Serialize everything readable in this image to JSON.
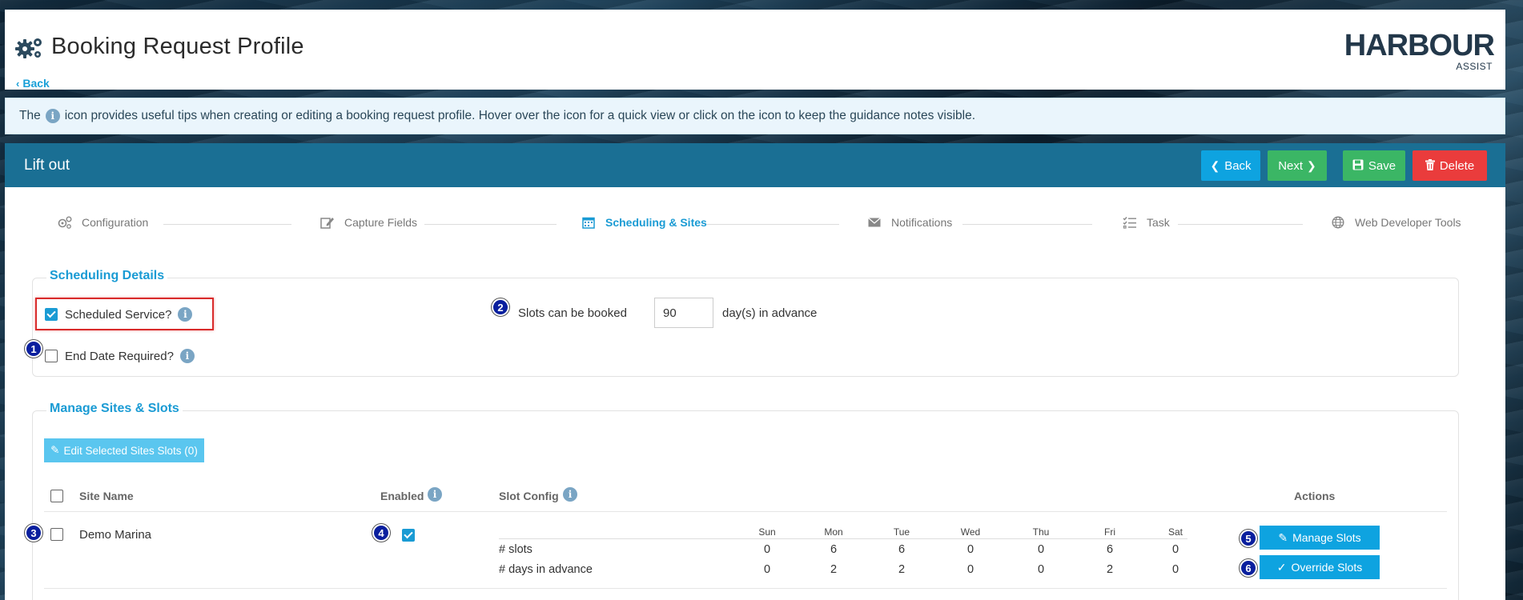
{
  "header": {
    "title": "Booking Request Profile",
    "back_label": "Back",
    "logo_main": "HARBOUR",
    "logo_sub": "ASSIST"
  },
  "tip": {
    "before": "The",
    "after": "icon provides useful tips when creating or editing a booking request profile. Hover over the icon for a quick view or click on the icon to keep the guidance notes visible."
  },
  "profile": {
    "name": "Lift out",
    "buttons": {
      "back": "Back",
      "next": "Next",
      "save": "Save",
      "delete": "Delete"
    }
  },
  "steps": [
    {
      "label": "Configuration",
      "icon": "cogs-icon",
      "active": false
    },
    {
      "label": "Capture Fields",
      "icon": "edit-icon",
      "active": false
    },
    {
      "label": "Scheduling & Sites",
      "icon": "calendar-icon",
      "active": true
    },
    {
      "label": "Notifications",
      "icon": "envelope-icon",
      "active": false
    },
    {
      "label": "Task",
      "icon": "tasklist-icon",
      "active": false
    },
    {
      "label": "Web Developer Tools",
      "icon": "globe-icon",
      "active": false
    }
  ],
  "scheduling": {
    "legend": "Scheduling Details",
    "scheduled_service_label": "Scheduled Service?",
    "scheduled_service_checked": true,
    "end_date_label": "End Date Required?",
    "end_date_checked": false,
    "slots_label": "Slots can be booked",
    "slots_value": "90",
    "slots_suffix": "day(s) in advance"
  },
  "sites": {
    "legend": "Manage Sites & Slots",
    "edit_selected_label": "Edit Selected Sites Slots (0)",
    "columns": {
      "site_name": "Site Name",
      "enabled": "Enabled",
      "slot_config": "Slot Config",
      "actions": "Actions"
    },
    "days": [
      "Sun",
      "Mon",
      "Tue",
      "Wed",
      "Thu",
      "Fri",
      "Sat"
    ],
    "rows": [
      {
        "site_name": "Demo Marina",
        "enabled": true,
        "slots_label": "# slots",
        "days_label": "# days in advance",
        "slots": [
          "0",
          "6",
          "6",
          "0",
          "0",
          "6",
          "0"
        ],
        "days_in_advance": [
          "0",
          "2",
          "2",
          "0",
          "0",
          "2",
          "0"
        ],
        "manage_label": "Manage Slots",
        "override_label": "Override Slots"
      }
    ]
  },
  "badges": [
    "1",
    "2",
    "3",
    "4",
    "5",
    "6"
  ],
  "colors": {
    "accent": "#1a9bd4",
    "panel_header": "#1a6f94",
    "green": "#3bb665",
    "red": "#ea3c3c",
    "badge": "#0a1f9e",
    "highlight": "#d92b2b"
  }
}
